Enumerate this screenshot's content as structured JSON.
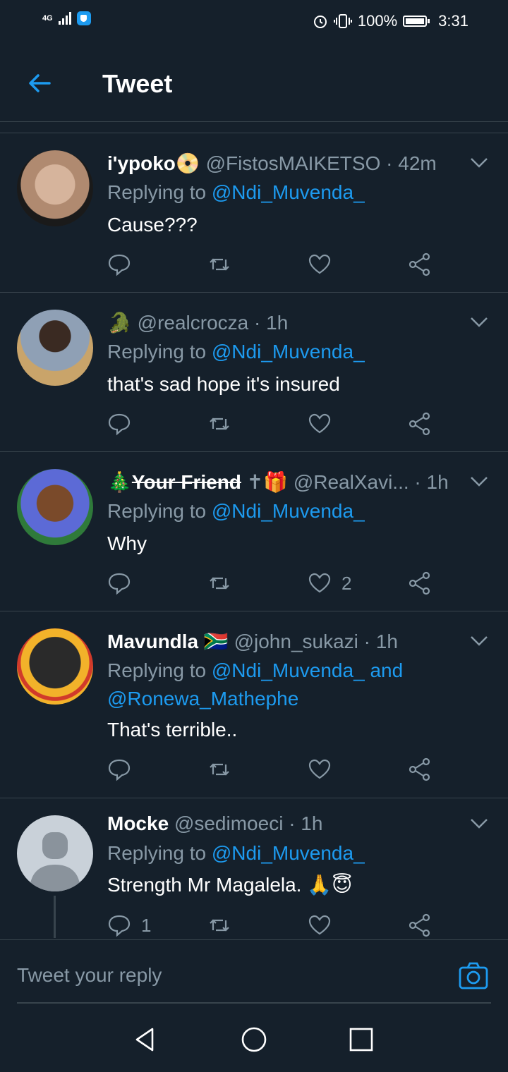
{
  "status_bar": {
    "network": "4G",
    "battery": "100%",
    "time": "3:31"
  },
  "header": {
    "title": "Tweet"
  },
  "tweets": [
    {
      "name": "i'ypoko",
      "name_emoji": "📀",
      "handle": "@FistosMAIKETSO",
      "time": "· 42m",
      "reply_prefix": "Replying to",
      "reply_to": "@Ndi_Muvenda_",
      "text": "Cause???",
      "replies": "",
      "likes": ""
    },
    {
      "name": "",
      "name_emoji": "🐊",
      "handle": "@realcrocza",
      "time": "· 1h",
      "reply_prefix": "Replying to",
      "reply_to": "@Ndi_Muvenda_",
      "text": "that's sad hope it's insured",
      "replies": "",
      "likes": ""
    },
    {
      "name_prefix_emoji": "🎄",
      "name": "Your Friend",
      "name_emoji": "✝🎁",
      "handle": "@RealXavi...",
      "time": "· 1h",
      "reply_prefix": "Replying to",
      "reply_to": "@Ndi_Muvenda_",
      "text": "Why",
      "replies": "",
      "likes": "2"
    },
    {
      "name": "Mavundla",
      "name_emoji": "🇿🇦",
      "handle": "@john_sukazi",
      "time": "· 1h",
      "reply_prefix": "Replying to",
      "reply_to": "@Ndi_Muvenda_",
      "reply_and": "and",
      "reply_to_2": "@Ronewa_Mathephe",
      "text": "That's terrible..",
      "replies": "",
      "likes": ""
    },
    {
      "name": "Mocke",
      "name_emoji": "",
      "handle": "@sedimoeci",
      "time": "· 1h",
      "reply_prefix": "Replying to",
      "reply_to": "@Ndi_Muvenda_",
      "text": "Strength Mr Magalela. 🙏😇",
      "replies": "1",
      "likes": ""
    }
  ],
  "composer": {
    "placeholder": "Tweet your reply"
  },
  "icons": {
    "back": "arrow-left-icon",
    "chevron": "chevron-down-icon",
    "reply": "reply-icon",
    "retweet": "retweet-icon",
    "like": "heart-icon",
    "share": "share-icon",
    "camera": "camera-icon"
  },
  "colors": {
    "background": "#15202b",
    "accent": "#1d9bf0",
    "muted": "#8899a6",
    "divider": "#38444d"
  }
}
